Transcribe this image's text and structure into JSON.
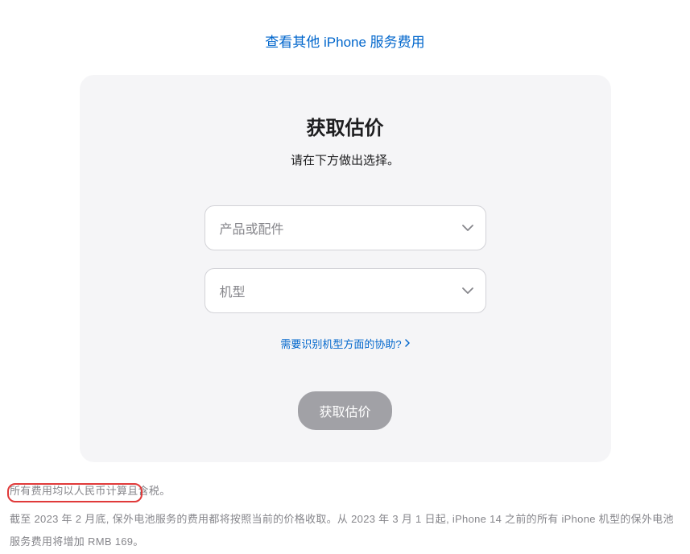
{
  "top_link": "查看其他 iPhone 服务费用",
  "card": {
    "title": "获取估价",
    "subtitle": "请在下方做出选择。",
    "select1_placeholder": "产品或配件",
    "select2_placeholder": "机型",
    "help_link": "需要识别机型方面的协助?",
    "submit_label": "获取估价"
  },
  "footer": {
    "para1": "所有费用均以人民币计算且含税。",
    "para2": "截至 2023 年 2 月底, 保外电池服务的费用都将按照当前的价格收取。从 2023 年 3 月 1 日起, iPhone 14 之前的所有 iPhone 机型的保外电池服务费用将增加 RMB 169。"
  }
}
